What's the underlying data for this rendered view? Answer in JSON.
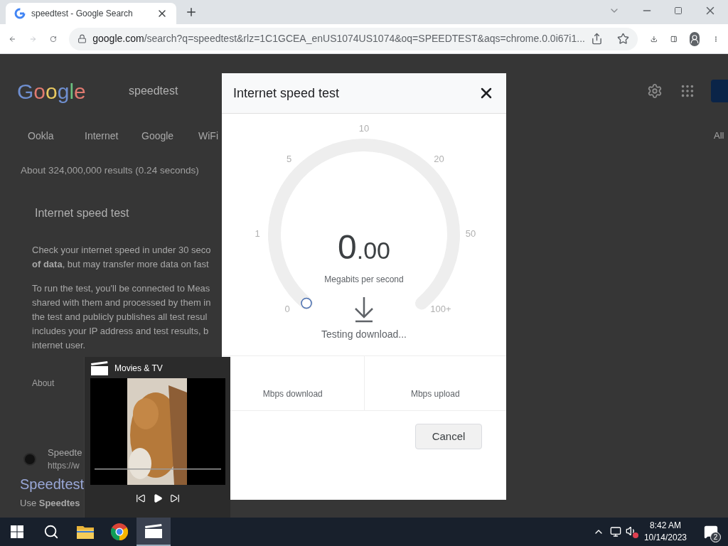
{
  "browser": {
    "tab": {
      "title": "speedtest - Google Search",
      "selected": true
    },
    "address": {
      "domain": "google.com",
      "path": "/search?q=speedtest&rlz=1C1GCEA_enUS1074US1074&oq=SPEEDTEST&aqs=chrome.0.0i67i1..."
    }
  },
  "google_page": {
    "logo": "Google",
    "query": "speedtest",
    "chips": [
      "Ookla",
      "Internet",
      "Google",
      "WiFi"
    ],
    "right_edge_label": "All",
    "result_stats": "About 324,000,000 results (0.24 seconds)",
    "widget_title": "Internet speed test",
    "paragraph_1": [
      "Check your internet speed in under 30 seco",
      "**of data**, but may transfer more data on fast"
    ],
    "paragraph_2": [
      "To run the test, you'll be connected to Meas",
      "shared with them and processed by them in",
      "the test and publicly publishes all test resul",
      "includes your IP address and test results, b",
      "internet user."
    ],
    "about_link": "About",
    "result": {
      "site": "Speedte",
      "url": "https://w",
      "title": "Speedtest",
      "snippet": "Use **Speedtes**"
    }
  },
  "dialog": {
    "title": "Internet speed test",
    "gauge": {
      "ticks": [
        "0",
        "1",
        "5",
        "10",
        "20",
        "50",
        "100+"
      ],
      "integer": "0",
      "decimals": ".00",
      "unit": "Megabits per second",
      "status": "Testing download..."
    },
    "results": [
      {
        "label": "Mbps download"
      },
      {
        "label": "Mbps upload"
      }
    ],
    "cancel": "Cancel"
  },
  "thumbnail_popup": {
    "title": "Movies & TV"
  },
  "taskbar": {
    "apps": [
      {
        "kind": "start",
        "selected": false
      },
      {
        "kind": "search",
        "selected": false
      },
      {
        "kind": "explorer",
        "selected": false
      },
      {
        "kind": "chrome",
        "selected": false
      },
      {
        "kind": "movies",
        "selected": true
      }
    ],
    "time": "8:42 AM",
    "date": "10/14/2023",
    "notifications": "2"
  }
}
